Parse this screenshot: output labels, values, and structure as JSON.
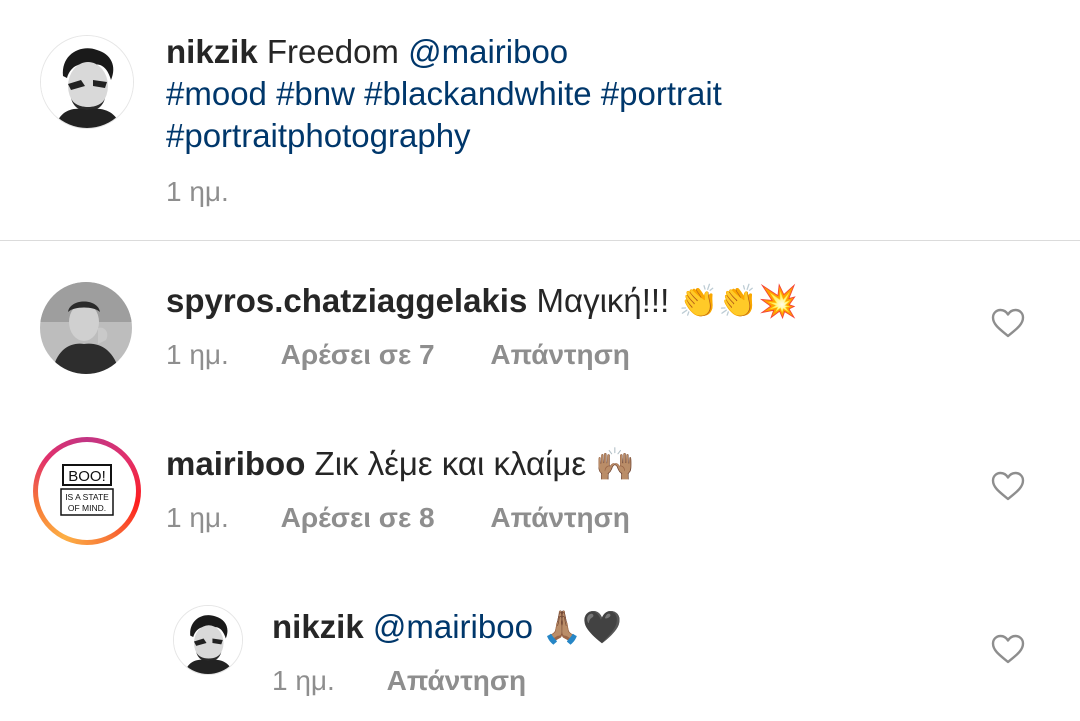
{
  "caption": {
    "username": "nikzik",
    "text": "Freedom",
    "mention": "@mairiboo",
    "hashtags_line1": "#mood #bnw #blackandwhite #portrait",
    "hashtags_line2": "#portraitphotography",
    "time": "1 ημ."
  },
  "comments": [
    {
      "username": "spyros.chatziaggelakis",
      "text": "Μαγική!!!",
      "emoji": "👏👏💥",
      "time": "1 ημ.",
      "likes": "Αρέσει σε 7",
      "reply": "Απάντηση",
      "avatar_icon": "profile-photo"
    },
    {
      "username": "mairiboo",
      "text": "Ζικ λέμε και κλαίμε",
      "emoji": "🙌🏽",
      "time": "1 ημ.",
      "likes": "Αρέσει σε 8",
      "reply": "Απάντηση",
      "avatar_icon": "boo-logo",
      "avatar_logo_text": [
        "BOO!",
        "IS A STATE",
        "OF MIND."
      ]
    }
  ],
  "reply": {
    "username": "nikzik",
    "mention": "@mairiboo",
    "emoji": "🙏🏽🖤",
    "time": "1 ημ.",
    "reply": "Απάντηση"
  },
  "icons": {
    "like": "heart-outline-icon"
  },
  "colors": {
    "text": "#262626",
    "link": "#00376b",
    "meta": "#8e8e8e",
    "divider": "#dbdbdb",
    "story_ring": [
      "#c13584",
      "#e1306c",
      "#fd1d1d",
      "#f77737",
      "#fcaf45"
    ]
  }
}
